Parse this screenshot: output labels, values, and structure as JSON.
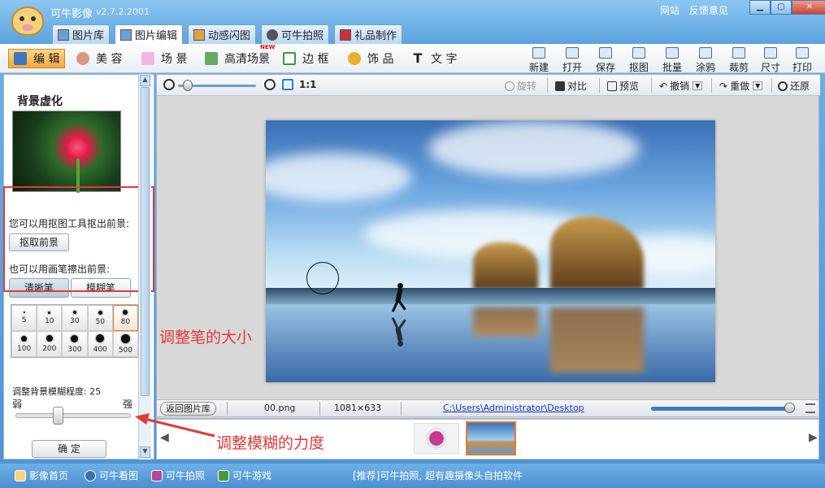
{
  "app": {
    "title": "可牛影像",
    "version": "v2.7.2.2001",
    "links": [
      "网站",
      "反馈意见"
    ]
  },
  "main_tabs": [
    {
      "label": "图片库"
    },
    {
      "label": "图片编辑"
    },
    {
      "label": "动感闪图"
    },
    {
      "label": "可牛拍照"
    },
    {
      "label": "礼品制作"
    }
  ],
  "tool_tabs": [
    {
      "label": "编 辑"
    },
    {
      "label": "美 容"
    },
    {
      "label": "场 景"
    },
    {
      "label": "高清场景"
    },
    {
      "label": "边 框"
    },
    {
      "label": "饰 品"
    },
    {
      "label": "文 字"
    }
  ],
  "new_badge": "NEW",
  "actions": [
    {
      "label": "新建"
    },
    {
      "label": "打开"
    },
    {
      "label": "保存"
    },
    {
      "label": "抠图"
    },
    {
      "label": "批量"
    },
    {
      "label": "涂鸦"
    },
    {
      "label": "裁剪"
    },
    {
      "label": "尺寸"
    },
    {
      "label": "打印"
    }
  ],
  "left_panel": {
    "title": "背景虚化",
    "hint1": "您可以用抠图工具抠出前景:",
    "extract_button": "抠取前景",
    "hint2": "也可以用画笔擦出前景:",
    "pen_tabs": [
      "清晰笔",
      "模糊笔"
    ],
    "brush_sizes": [
      "5",
      "10",
      "30",
      "50",
      "80",
      "100",
      "200",
      "300",
      "400",
      "500"
    ],
    "selected_size": "80",
    "blur_label": "调整背景模糊程度: 25",
    "blur_value": 25,
    "weak": "弱",
    "strong": "强",
    "confirm": "确 定"
  },
  "canvas_toolbar": {
    "ratio": "1:1",
    "rotate": "旋转",
    "compare": "对比",
    "preview": "预览",
    "undo": "撤销",
    "redo": "重做",
    "restore": "还原"
  },
  "status": {
    "back": "返回图片库",
    "filename": "00.png",
    "size": "1081×633",
    "path": "C:\\Users\\Administrator\\Desktop"
  },
  "bottom": {
    "links": [
      "影像首页",
      "可牛看图",
      "可牛拍照",
      "可牛游戏"
    ],
    "promo": "[推荐]可牛拍照, 超有趣摄像头自拍软件"
  },
  "annotations": {
    "pen_size": "调整笔的大小",
    "blur_strength": "调整模糊的力度"
  },
  "colors": {
    "accent": "#e23a3a",
    "active_tab": "#f2a93b",
    "frame": "#5a9fdc"
  }
}
